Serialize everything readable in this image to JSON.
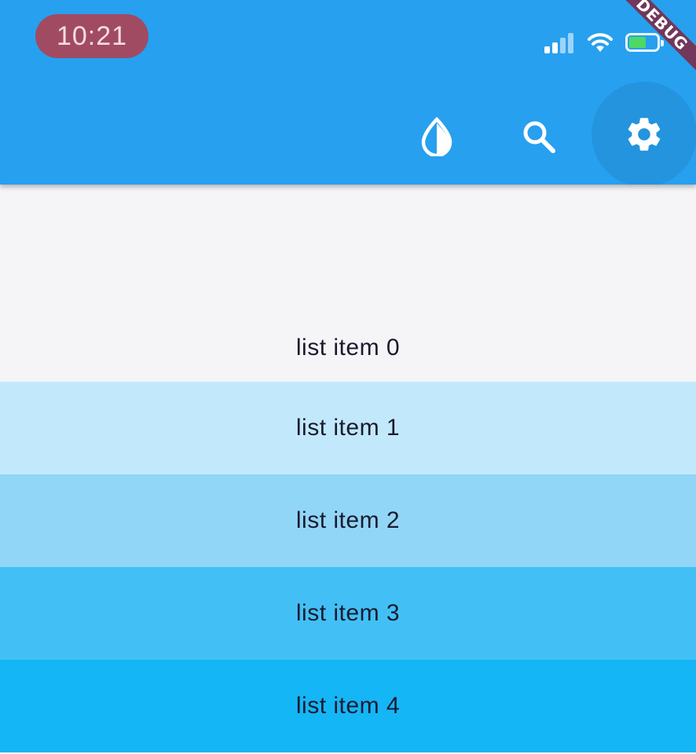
{
  "status_bar": {
    "time": "10:21"
  },
  "app_bar": {
    "background": "#27a0ef",
    "actions": [
      {
        "icon": "water-drop-icon"
      },
      {
        "icon": "search-icon"
      },
      {
        "icon": "settings-gear-icon"
      }
    ]
  },
  "debug_banner": {
    "label": "DEBUG"
  },
  "list": {
    "items": [
      {
        "label": "list item 0",
        "color": "#f5f4f6"
      },
      {
        "label": "list item 1",
        "color": "#c2e9fb"
      },
      {
        "label": "list item 2",
        "color": "#92d6f7"
      },
      {
        "label": "list item 3",
        "color": "#42c0f6"
      },
      {
        "label": "list item 4",
        "color": "#14b6f6"
      }
    ]
  }
}
